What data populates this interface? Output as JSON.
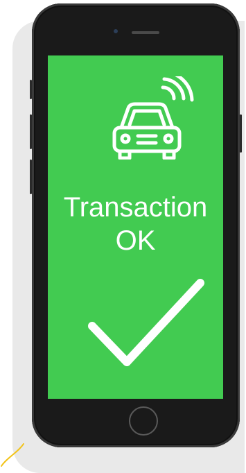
{
  "screen": {
    "title_line1": "Transaction",
    "title_line2": "OK",
    "background_color": "#42cb51",
    "icons": [
      "car-wireless-icon",
      "checkmark-icon"
    ]
  },
  "device": {
    "type": "smartphone",
    "body_color": "#1a1a1a"
  }
}
